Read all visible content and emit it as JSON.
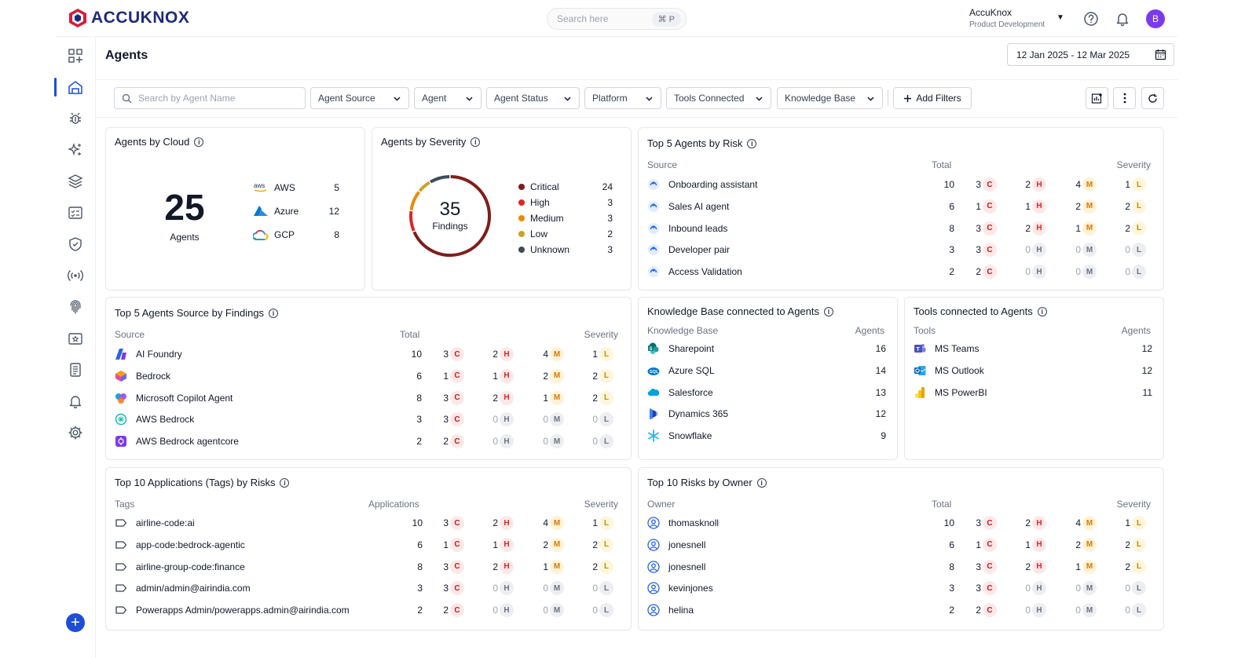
{
  "brand": {
    "name": "ACCUKNOX"
  },
  "topbar": {
    "search_placeholder": "Search here",
    "shortcut": "⌘ P",
    "org_name": "AccuKnox",
    "org_sub": "Product Development",
    "avatar_initial": "B"
  },
  "page": {
    "title": "Agents",
    "date_range": "12 Jan 2025 - 12 Mar 2025"
  },
  "filters": {
    "search_placeholder": "Search by Agent Name",
    "dropdowns": [
      "Agent Source",
      "Agent",
      "Agent Status",
      "Platform",
      "Tools Connected",
      "Knowledge Base"
    ],
    "add_filters": "Add Filters"
  },
  "cloud": {
    "title": "Agents by Cloud",
    "total": "25",
    "total_label": "Agents",
    "items": [
      {
        "name": "AWS",
        "count": "5"
      },
      {
        "name": "Azure",
        "count": "12"
      },
      {
        "name": "GCP",
        "count": "8"
      }
    ]
  },
  "severity": {
    "title": "Agents by Severity",
    "total": "35",
    "total_label": "Findings",
    "items": [
      {
        "name": "Critical",
        "count": 24,
        "color": "#7f1d1d"
      },
      {
        "name": "High",
        "count": 3,
        "color": "#dc2626"
      },
      {
        "name": "Medium",
        "count": 3,
        "color": "#ea8a0c"
      },
      {
        "name": "Low",
        "count": 2,
        "color": "#c9a227"
      },
      {
        "name": "Unknown",
        "count": 3,
        "color": "#3f4a5a"
      }
    ]
  },
  "top5_risk": {
    "title": "Top 5 Agents by Risk",
    "h_source": "Source",
    "h_total": "Total",
    "h_severity": "Severity",
    "rows": [
      {
        "name": "Onboarding assistant",
        "total": "10",
        "c": "3",
        "h": "2",
        "m": "4",
        "l": "1"
      },
      {
        "name": "Sales AI agent",
        "total": "6",
        "c": "1",
        "h": "1",
        "m": "2",
        "l": "2"
      },
      {
        "name": "Inbound leads",
        "total": "8",
        "c": "3",
        "h": "2",
        "m": "1",
        "l": "2"
      },
      {
        "name": "Developer pair",
        "total": "3",
        "c": "3",
        "h": "0",
        "m": "0",
        "l": "0"
      },
      {
        "name": "Access Validation",
        "total": "2",
        "c": "2",
        "h": "0",
        "m": "0",
        "l": "0"
      }
    ]
  },
  "top5_source": {
    "title": "Top 5 Agents Source by Findings",
    "h_source": "Source",
    "h_total": "Total",
    "h_severity": "Severity",
    "rows": [
      {
        "name": "AI Foundry",
        "icon": "ai-foundry-icon",
        "total": "10",
        "c": "3",
        "h": "2",
        "m": "4",
        "l": "1"
      },
      {
        "name": "Bedrock",
        "icon": "bedrock-icon",
        "total": "6",
        "c": "1",
        "h": "1",
        "m": "2",
        "l": "2"
      },
      {
        "name": "Microsoft Copilot Agent",
        "icon": "copilot-icon",
        "total": "8",
        "c": "3",
        "h": "2",
        "m": "1",
        "l": "2"
      },
      {
        "name": "AWS Bedrock",
        "icon": "aws-bedrock-icon",
        "total": "3",
        "c": "3",
        "h": "0",
        "m": "0",
        "l": "0"
      },
      {
        "name": "AWS Bedrock agentcore",
        "icon": "agentcore-icon",
        "total": "2",
        "c": "2",
        "h": "0",
        "m": "0",
        "l": "0"
      }
    ]
  },
  "kb": {
    "title": "Knowledge Base connected to Agents",
    "h_name": "Knowledge Base",
    "h_agents": "Agents",
    "rows": [
      {
        "name": "Sharepoint",
        "icon": "sharepoint-icon",
        "count": "16"
      },
      {
        "name": "Azure SQL",
        "icon": "azure-sql-icon",
        "count": "14"
      },
      {
        "name": "Salesforce",
        "icon": "salesforce-icon",
        "count": "13"
      },
      {
        "name": "Dynamics 365",
        "icon": "dynamics-icon",
        "count": "12"
      },
      {
        "name": "Snowflake",
        "icon": "snowflake-icon",
        "count": "9"
      }
    ]
  },
  "tools": {
    "title": "Tools connected to Agents",
    "h_name": "Tools",
    "h_agents": "Agents",
    "rows": [
      {
        "name": "MS Teams",
        "icon": "teams-icon",
        "count": "12"
      },
      {
        "name": "MS Outlook",
        "icon": "outlook-icon",
        "count": "12"
      },
      {
        "name": "MS PowerBI",
        "icon": "powerbi-icon",
        "count": "11"
      }
    ]
  },
  "apps": {
    "title": "Top 10 Applications (Tags) by Risks",
    "h_name": "Tags",
    "h_total": "Applications",
    "h_severity": "Severity",
    "rows": [
      {
        "name": "airline-code:ai",
        "total": "10",
        "c": "3",
        "h": "2",
        "m": "4",
        "l": "1"
      },
      {
        "name": "app-code:bedrock-agentic",
        "total": "6",
        "c": "1",
        "h": "1",
        "m": "2",
        "l": "2"
      },
      {
        "name": "airline-group-code:finance",
        "total": "8",
        "c": "3",
        "h": "2",
        "m": "1",
        "l": "2"
      },
      {
        "name": "admin/admin@airindia.com",
        "total": "3",
        "c": "3",
        "h": "0",
        "m": "0",
        "l": "0"
      },
      {
        "name": "Powerapps Admin/powerapps.admin@airindia.com",
        "total": "2",
        "c": "2",
        "h": "0",
        "m": "0",
        "l": "0"
      }
    ]
  },
  "owners": {
    "title": "Top 10 Risks by Owner",
    "h_name": "Owner",
    "h_total": "Total",
    "h_severity": "Severity",
    "rows": [
      {
        "name": "thomasknoll",
        "total": "10",
        "c": "3",
        "h": "2",
        "m": "4",
        "l": "1"
      },
      {
        "name": "jonesnell",
        "total": "6",
        "c": "1",
        "h": "1",
        "m": "2",
        "l": "2"
      },
      {
        "name": "jonesnell",
        "total": "8",
        "c": "3",
        "h": "2",
        "m": "1",
        "l": "2"
      },
      {
        "name": "kevinjones",
        "total": "3",
        "c": "3",
        "h": "0",
        "m": "0",
        "l": "0"
      },
      {
        "name": "helina",
        "total": "2",
        "c": "2",
        "h": "0",
        "m": "0",
        "l": "0"
      }
    ]
  }
}
